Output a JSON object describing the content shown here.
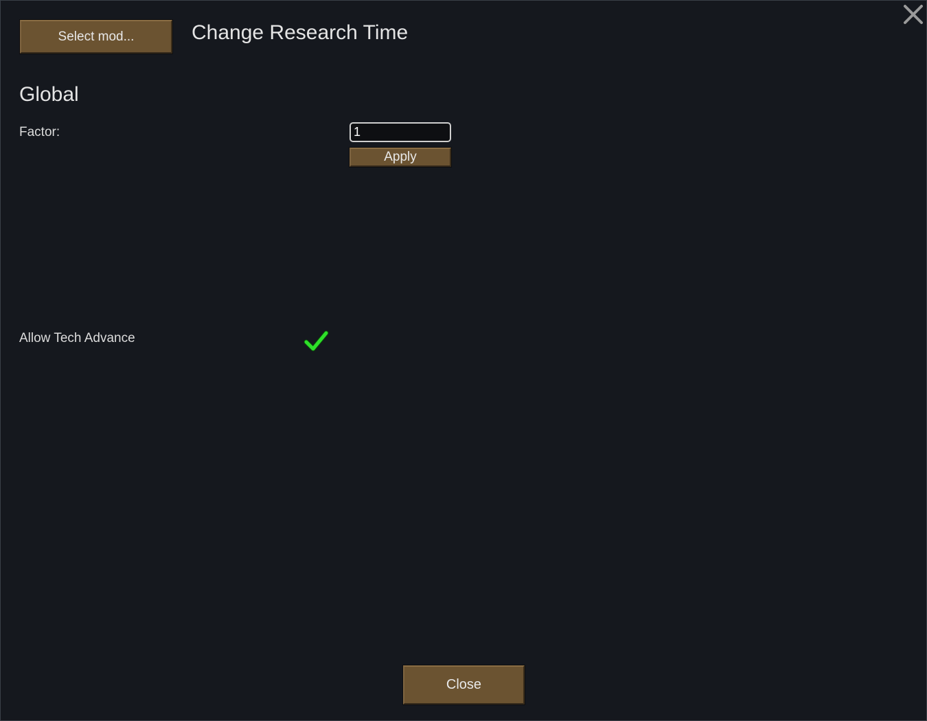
{
  "header": {
    "select_mod_label": "Select mod...",
    "title": "Change Research Time"
  },
  "global": {
    "section_title": "Global",
    "factor_label": "Factor:",
    "factor_value": "1",
    "apply_label": "Apply"
  },
  "options": {
    "allow_tech_advance_label": "Allow Tech Advance",
    "allow_tech_advance_checked": true
  },
  "footer": {
    "close_label": "Close"
  },
  "icons": {
    "close": "close-x-icon",
    "check": "checkmark-icon"
  },
  "colors": {
    "background": "#15181e",
    "button": "#6b5331",
    "check": "#2ee02a",
    "close_x": "#9a9a9a"
  }
}
